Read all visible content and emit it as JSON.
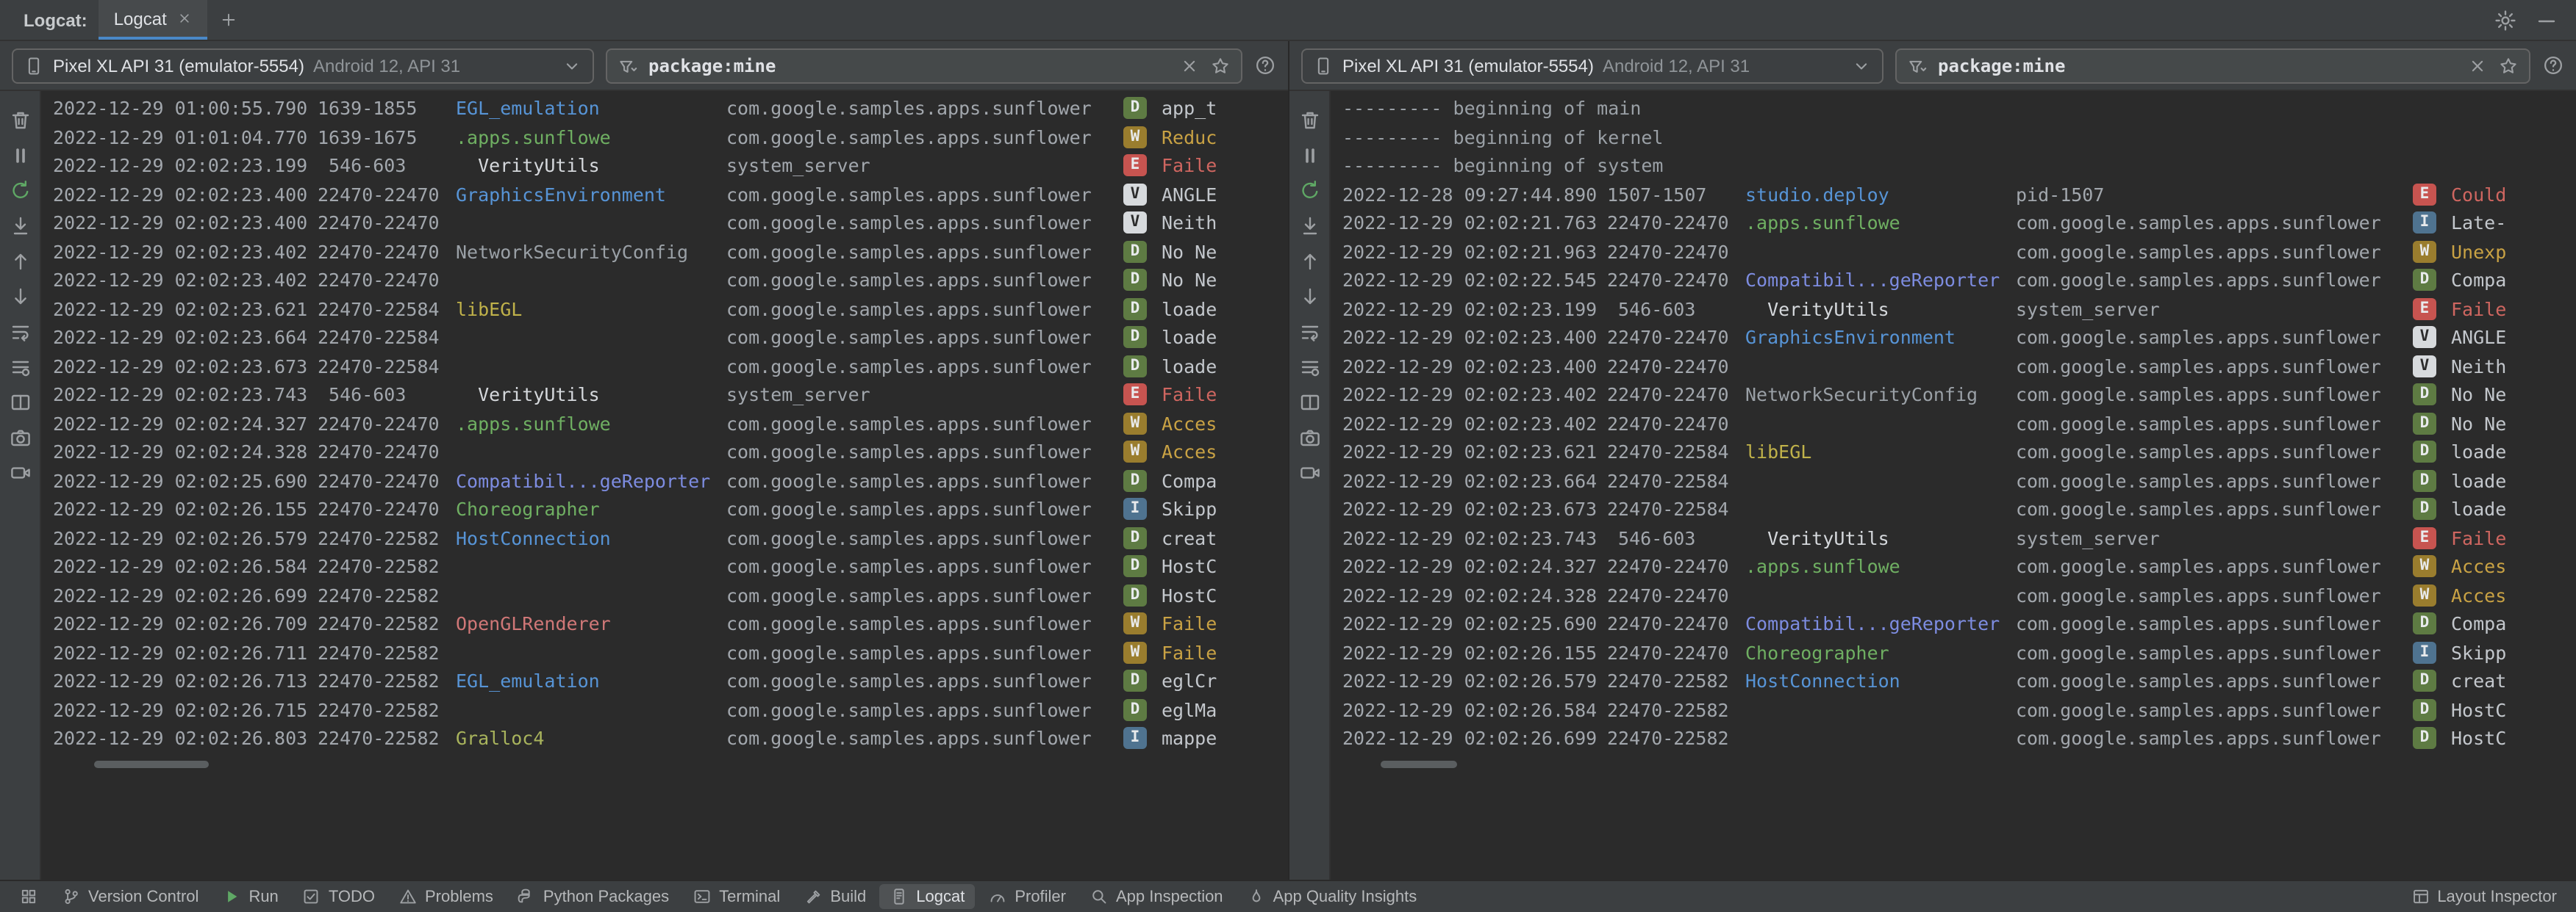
{
  "tab_bar": {
    "title": "Logcat:",
    "tabs": [
      {
        "label": "Logcat",
        "active": true,
        "closable": true
      }
    ],
    "icons": {
      "add": "plus-icon",
      "settings": "gear-icon",
      "hide": "minimize-icon"
    }
  },
  "palette": {
    "tags": {
      "blue": "#5794d6",
      "green": "#6faf62",
      "white": "#d5d8dc",
      "gray": "#9aa0a6",
      "yellow": "#c0b24a",
      "indigo": "#7d8ce0",
      "pink": "#d07777",
      "olive": "#a8b35c"
    },
    "levels": {
      "D": {
        "bg": "#5e7b43",
        "fg": "#e8eaec"
      },
      "W": {
        "bg": "#9a7d2e",
        "fg": "#e8eaec"
      },
      "E": {
        "bg": "#c75450",
        "fg": "#e8eaec"
      },
      "V": {
        "bg": "#d7dadd",
        "fg": "#2b2b2b"
      },
      "I": {
        "bg": "#4f7390",
        "fg": "#e8eaec"
      }
    },
    "msg": {
      "W": "#c9a244",
      "E": "#cf6660"
    }
  },
  "log_toolbar": {
    "icons": [
      {
        "name": "trash"
      },
      {
        "name": "pause"
      },
      {
        "name": "rerun"
      },
      {
        "name": "scroll-end"
      },
      {
        "name": "arrow-up"
      },
      {
        "name": "arrow-down"
      },
      {
        "name": "soft-wrap"
      },
      {
        "name": "format"
      },
      {
        "name": "split"
      },
      {
        "name": "camera"
      },
      {
        "name": "video"
      }
    ]
  },
  "panels": [
    {
      "device": {
        "name": "Pixel XL API 31 (emulator-5554)",
        "detail": "Android 12, API 31"
      },
      "filter": {
        "value": "package:mine"
      },
      "rows": [
        {
          "t": "2022-12-29 01:00:55.790",
          "p": "1639-1855",
          "g": "EGL_emulation",
          "c": "blue",
          "k": "com.google.samples.apps.sunflower",
          "l": "D",
          "m": "app_t"
        },
        {
          "t": "2022-12-29 01:01:04.770",
          "p": "1639-1675",
          "g": ".apps.sunflowe",
          "c": "green",
          "k": "com.google.samples.apps.sunflower",
          "l": "W",
          "m": "Reduc"
        },
        {
          "t": "2022-12-29 02:02:23.199",
          "p": " 546-603",
          "g": "  VerityUtils",
          "c": "white",
          "k": "system_server",
          "l": "E",
          "m": "Faile"
        },
        {
          "t": "2022-12-29 02:02:23.400",
          "p": "22470-22470",
          "g": "GraphicsEnvironment",
          "c": "blue",
          "k": "com.google.samples.apps.sunflower",
          "l": "V",
          "m": "ANGLE"
        },
        {
          "t": "2022-12-29 02:02:23.400",
          "p": "22470-22470",
          "g": "",
          "k": "com.google.samples.apps.sunflower",
          "l": "V",
          "m": "Neith"
        },
        {
          "t": "2022-12-29 02:02:23.402",
          "p": "22470-22470",
          "g": "NetworkSecurityConfig",
          "c": "gray",
          "k": "com.google.samples.apps.sunflower",
          "l": "D",
          "m": "No Ne"
        },
        {
          "t": "2022-12-29 02:02:23.402",
          "p": "22470-22470",
          "g": "",
          "k": "com.google.samples.apps.sunflower",
          "l": "D",
          "m": "No Ne"
        },
        {
          "t": "2022-12-29 02:02:23.621",
          "p": "22470-22584",
          "g": "libEGL",
          "c": "yellow",
          "k": "com.google.samples.apps.sunflower",
          "l": "D",
          "m": "loade"
        },
        {
          "t": "2022-12-29 02:02:23.664",
          "p": "22470-22584",
          "g": "",
          "k": "com.google.samples.apps.sunflower",
          "l": "D",
          "m": "loade"
        },
        {
          "t": "2022-12-29 02:02:23.673",
          "p": "22470-22584",
          "g": "",
          "k": "com.google.samples.apps.sunflower",
          "l": "D",
          "m": "loade"
        },
        {
          "t": "2022-12-29 02:02:23.743",
          "p": " 546-603",
          "g": "  VerityUtils",
          "c": "white",
          "k": "system_server",
          "l": "E",
          "m": "Faile"
        },
        {
          "t": "2022-12-29 02:02:24.327",
          "p": "22470-22470",
          "g": ".apps.sunflowe",
          "c": "green",
          "k": "com.google.samples.apps.sunflower",
          "l": "W",
          "m": "Acces"
        },
        {
          "t": "2022-12-29 02:02:24.328",
          "p": "22470-22470",
          "g": "",
          "k": "com.google.samples.apps.sunflower",
          "l": "W",
          "m": "Acces"
        },
        {
          "t": "2022-12-29 02:02:25.690",
          "p": "22470-22470",
          "g": "Compatibil...geReporter",
          "c": "indigo",
          "k": "com.google.samples.apps.sunflower",
          "l": "D",
          "m": "Compa"
        },
        {
          "t": "2022-12-29 02:02:26.155",
          "p": "22470-22470",
          "g": "Choreographer",
          "c": "green",
          "k": "com.google.samples.apps.sunflower",
          "l": "I",
          "m": "Skipp"
        },
        {
          "t": "2022-12-29 02:02:26.579",
          "p": "22470-22582",
          "g": "HostConnection",
          "c": "blue",
          "k": "com.google.samples.apps.sunflower",
          "l": "D",
          "m": "creat"
        },
        {
          "t": "2022-12-29 02:02:26.584",
          "p": "22470-22582",
          "g": "",
          "k": "com.google.samples.apps.sunflower",
          "l": "D",
          "m": "HostC"
        },
        {
          "t": "2022-12-29 02:02:26.699",
          "p": "22470-22582",
          "g": "",
          "k": "com.google.samples.apps.sunflower",
          "l": "D",
          "m": "HostC"
        },
        {
          "t": "2022-12-29 02:02:26.709",
          "p": "22470-22582",
          "g": "OpenGLRenderer",
          "c": "pink",
          "k": "com.google.samples.apps.sunflower",
          "l": "W",
          "m": "Faile"
        },
        {
          "t": "2022-12-29 02:02:26.711",
          "p": "22470-22582",
          "g": "",
          "k": "com.google.samples.apps.sunflower",
          "l": "W",
          "m": "Faile"
        },
        {
          "t": "2022-12-29 02:02:26.713",
          "p": "22470-22582",
          "g": "EGL_emulation",
          "c": "blue",
          "k": "com.google.samples.apps.sunflower",
          "l": "D",
          "m": "eglCr"
        },
        {
          "t": "2022-12-29 02:02:26.715",
          "p": "22470-22582",
          "g": "",
          "k": "com.google.samples.apps.sunflower",
          "l": "D",
          "m": "eglMa"
        },
        {
          "t": "2022-12-29 02:02:26.803",
          "p": "22470-22582",
          "g": "Gralloc4",
          "c": "olive",
          "k": "com.google.samples.apps.sunflower",
          "l": "I",
          "m": "mappe"
        }
      ]
    },
    {
      "device": {
        "name": "Pixel XL API 31 (emulator-5554)",
        "detail": "Android 12, API 31"
      },
      "filter": {
        "value": "package:mine"
      },
      "rows": [
        {
          "meta": "--------- beginning of main"
        },
        {
          "meta": "--------- beginning of kernel"
        },
        {
          "meta": "--------- beginning of system"
        },
        {
          "t": "2022-12-28 09:27:44.890",
          "p": "1507-1507",
          "g": "studio.deploy",
          "c": "blue",
          "k": "pid-1507",
          "l": "E",
          "m": "Could"
        },
        {
          "t": "2022-12-29 02:02:21.763",
          "p": "22470-22470",
          "g": ".apps.sunflowe",
          "c": "green",
          "k": "com.google.samples.apps.sunflower",
          "l": "I",
          "m": "Late-"
        },
        {
          "t": "2022-12-29 02:02:21.963",
          "p": "22470-22470",
          "g": "",
          "k": "com.google.samples.apps.sunflower",
          "l": "W",
          "m": "Unexp"
        },
        {
          "t": "2022-12-29 02:02:22.545",
          "p": "22470-22470",
          "g": "Compatibil...geReporter",
          "c": "indigo",
          "k": "com.google.samples.apps.sunflower",
          "l": "D",
          "m": "Compa"
        },
        {
          "t": "2022-12-29 02:02:23.199",
          "p": " 546-603",
          "g": "  VerityUtils",
          "c": "white",
          "k": "system_server",
          "l": "E",
          "m": "Faile"
        },
        {
          "t": "2022-12-29 02:02:23.400",
          "p": "22470-22470",
          "g": "GraphicsEnvironment",
          "c": "blue",
          "k": "com.google.samples.apps.sunflower",
          "l": "V",
          "m": "ANGLE"
        },
        {
          "t": "2022-12-29 02:02:23.400",
          "p": "22470-22470",
          "g": "",
          "k": "com.google.samples.apps.sunflower",
          "l": "V",
          "m": "Neith"
        },
        {
          "t": "2022-12-29 02:02:23.402",
          "p": "22470-22470",
          "g": "NetworkSecurityConfig",
          "c": "gray",
          "k": "com.google.samples.apps.sunflower",
          "l": "D",
          "m": "No Ne"
        },
        {
          "t": "2022-12-29 02:02:23.402",
          "p": "22470-22470",
          "g": "",
          "k": "com.google.samples.apps.sunflower",
          "l": "D",
          "m": "No Ne"
        },
        {
          "t": "2022-12-29 02:02:23.621",
          "p": "22470-22584",
          "g": "libEGL",
          "c": "yellow",
          "k": "com.google.samples.apps.sunflower",
          "l": "D",
          "m": "loade"
        },
        {
          "t": "2022-12-29 02:02:23.664",
          "p": "22470-22584",
          "g": "",
          "k": "com.google.samples.apps.sunflower",
          "l": "D",
          "m": "loade"
        },
        {
          "t": "2022-12-29 02:02:23.673",
          "p": "22470-22584",
          "g": "",
          "k": "com.google.samples.apps.sunflower",
          "l": "D",
          "m": "loade"
        },
        {
          "t": "2022-12-29 02:02:23.743",
          "p": " 546-603",
          "g": "  VerityUtils",
          "c": "white",
          "k": "system_server",
          "l": "E",
          "m": "Faile"
        },
        {
          "t": "2022-12-29 02:02:24.327",
          "p": "22470-22470",
          "g": ".apps.sunflowe",
          "c": "green",
          "k": "com.google.samples.apps.sunflower",
          "l": "W",
          "m": "Acces"
        },
        {
          "t": "2022-12-29 02:02:24.328",
          "p": "22470-22470",
          "g": "",
          "k": "com.google.samples.apps.sunflower",
          "l": "W",
          "m": "Acces"
        },
        {
          "t": "2022-12-29 02:02:25.690",
          "p": "22470-22470",
          "g": "Compatibil...geReporter",
          "c": "indigo",
          "k": "com.google.samples.apps.sunflower",
          "l": "D",
          "m": "Compa"
        },
        {
          "t": "2022-12-29 02:02:26.155",
          "p": "22470-22470",
          "g": "Choreographer",
          "c": "green",
          "k": "com.google.samples.apps.sunflower",
          "l": "I",
          "m": "Skipp"
        },
        {
          "t": "2022-12-29 02:02:26.579",
          "p": "22470-22582",
          "g": "HostConnection",
          "c": "blue",
          "k": "com.google.samples.apps.sunflower",
          "l": "D",
          "m": "creat"
        },
        {
          "t": "2022-12-29 02:02:26.584",
          "p": "22470-22582",
          "g": "",
          "k": "com.google.samples.apps.sunflower",
          "l": "D",
          "m": "HostC"
        },
        {
          "t": "2022-12-29 02:02:26.699",
          "p": "22470-22582",
          "g": "",
          "k": "com.google.samples.apps.sunflower",
          "l": "D",
          "m": "HostC"
        }
      ]
    }
  ],
  "status_bar": {
    "left": [
      {
        "icon": "grid",
        "label": ""
      },
      {
        "icon": "branch",
        "label": "Version Control"
      },
      {
        "icon": "play",
        "label": "Run"
      },
      {
        "icon": "todo",
        "label": "TODO"
      },
      {
        "icon": "warning",
        "label": "Problems"
      },
      {
        "icon": "python",
        "label": "Python Packages"
      },
      {
        "icon": "terminal",
        "label": "Terminal"
      },
      {
        "icon": "hammer",
        "label": "Build"
      },
      {
        "icon": "logcat",
        "label": "Logcat",
        "active": true
      },
      {
        "icon": "profiler",
        "label": "Profiler"
      },
      {
        "icon": "inspect",
        "label": "App Inspection"
      },
      {
        "icon": "flame",
        "label": "App Quality Insights"
      }
    ],
    "right": [
      {
        "icon": "layout",
        "label": "Layout Inspector"
      }
    ]
  }
}
